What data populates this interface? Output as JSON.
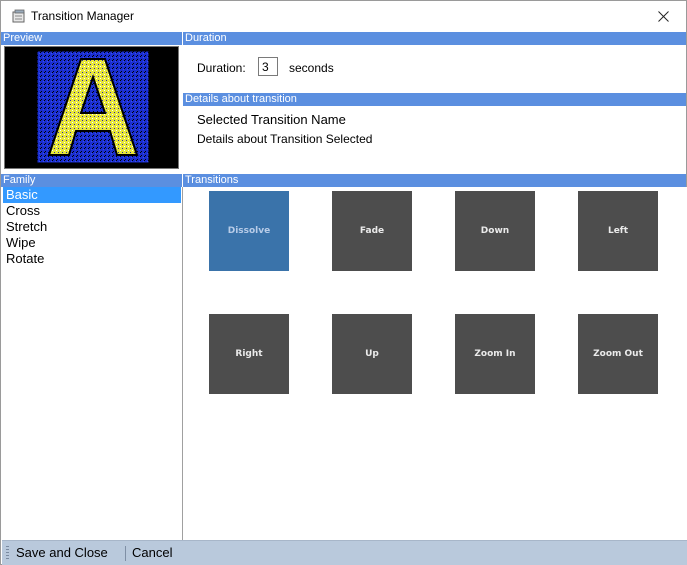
{
  "window": {
    "title": "Transition Manager"
  },
  "sections": {
    "preview": "Preview",
    "duration": "Duration",
    "details": "Details about transition",
    "family": "Family",
    "transitions": "Transitions"
  },
  "duration": {
    "label": "Duration:",
    "value": "3",
    "unit": "seconds"
  },
  "details": {
    "name": "Selected Transition Name",
    "text": "Details about Transition Selected"
  },
  "family": {
    "items": [
      "Basic",
      "Cross",
      "Stretch",
      "Wipe",
      "Rotate"
    ],
    "selected": "Basic"
  },
  "transitions": {
    "tiles": [
      "Dissolve",
      "Fade",
      "Down",
      "Left",
      "Right",
      "Up",
      "Zoom In",
      "Zoom Out"
    ],
    "selected": "Dissolve"
  },
  "footer": {
    "save_label": "Save and Close",
    "cancel_label": "Cancel"
  },
  "colors": {
    "header": "#5b8fe0",
    "selection": "#3399ff",
    "tile": "#4d4d4d",
    "tile_selected": "#3a73aa",
    "footer": "#b9c9dc"
  },
  "icons": {
    "app": "app-icon",
    "close": "close-icon",
    "preview_letter": "letter-a-image"
  }
}
